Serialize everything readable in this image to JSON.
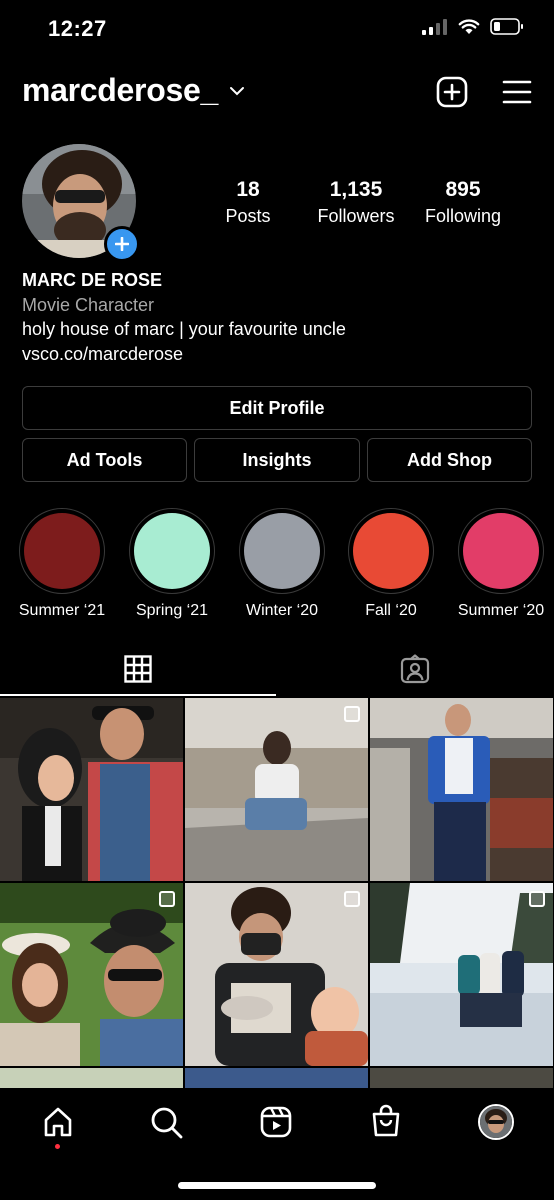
{
  "status_bar": {
    "time": "12:27"
  },
  "header": {
    "username": "marcderose_"
  },
  "stats": [
    {
      "value": "18",
      "label": "Posts"
    },
    {
      "value": "1,135",
      "label": "Followers"
    },
    {
      "value": "895",
      "label": "Following"
    }
  ],
  "bio": {
    "name": "MARC DE ROSE",
    "category": "Movie Character",
    "text": "holy house of marc | your favourite uncle",
    "link": "vsco.co/marcderose"
  },
  "buttons": {
    "edit_profile": "Edit Profile",
    "ad_tools": "Ad Tools",
    "insights": "Insights",
    "add_shop": "Add Shop"
  },
  "highlights": [
    {
      "label": "Summer ‘21",
      "color": "#7d1c1c"
    },
    {
      "label": "Spring ‘21",
      "color": "#a8ecd2"
    },
    {
      "label": "Winter ‘20",
      "color": "#999ea6"
    },
    {
      "label": "Fall ‘20",
      "color": "#e84a35"
    },
    {
      "label": "Summer ‘20",
      "color": "#e23d68"
    }
  ],
  "tabs": [
    "grid-icon",
    "tagged-icon"
  ],
  "nav": [
    "home-icon",
    "search-icon",
    "reels-icon",
    "shop-icon",
    "profile-avatar"
  ],
  "colors": {
    "accent": "#3897f0",
    "notification_dot": "#ff3040",
    "border": "#3c3c3c"
  }
}
